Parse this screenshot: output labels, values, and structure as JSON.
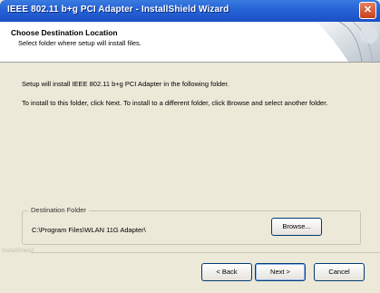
{
  "window": {
    "title": "IEEE 802.11 b+g PCI Adapter - InstallShield Wizard",
    "close_glyph": "✕"
  },
  "header": {
    "title": "Choose Destination Location",
    "subtitle": "Select folder where setup will install files."
  },
  "body": {
    "line1": "Setup will install IEEE 802.11 b+g PCI Adapter in the following folder.",
    "line2": "To install to this folder, click Next. To install to a different folder, click Browse and select another folder."
  },
  "destination": {
    "group_label": "Destination Folder",
    "path": "C:\\Program Files\\WLAN 11G Adapter\\"
  },
  "buttons": {
    "browse": "Browse...",
    "back": "< Back",
    "next": "Next >",
    "cancel": "Cancel"
  },
  "branding": {
    "installshield": "InstallShield"
  }
}
